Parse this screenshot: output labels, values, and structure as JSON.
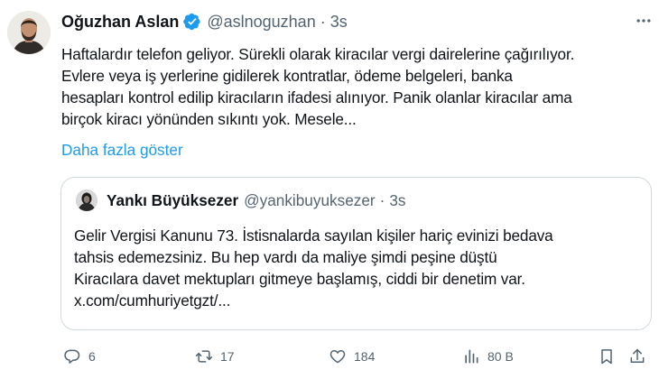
{
  "tweet": {
    "author_name": "Oğuzhan Aslan",
    "handle": "@aslnoguzhan",
    "separator": "·",
    "time": "3s",
    "body_lines": [
      "Haftalardır telefon geliyor. Sürekli olarak kiracılar vergi dairelerine çağırılıyor.",
      "Evlere veya iş yerlerine gidilerek kontratlar, ödeme belgeleri, banka",
      "hesapları kontrol edilip kiracıların ifadesi alınıyor. Panik olanlar kiracılar ama",
      "birçok kiracı yönünden sıkıntı yok. Mesele..."
    ],
    "show_more": "Daha fazla göster"
  },
  "quote": {
    "author_name": "Yankı Büyüksezer",
    "handle": "@yankibuyuksezer",
    "separator": "·",
    "time": "3s",
    "body_lines": [
      "Gelir Vergisi Kanunu 73. İstisnalarda sayılan kişiler hariç evinizi bedava",
      "tahsis edemezsiniz. Bu hep vardı da maliye şimdi peşine düştü",
      "Kiracılara davet mektupları gitmeye başlamış, ciddi bir denetim var.",
      "x.com/cumhuriyetgzt/..."
    ]
  },
  "actions": {
    "replies": "6",
    "reposts": "17",
    "likes": "184",
    "views": "80 B"
  },
  "icons": {
    "verified": "verified-badge-icon",
    "more": "more-dots-icon",
    "reply": "reply-bubble-icon",
    "repost": "repost-arrows-icon",
    "like": "heart-icon",
    "views": "bar-chart-icon",
    "bookmark": "bookmark-icon",
    "share": "share-upload-icon"
  },
  "colors": {
    "text": "#0f1419",
    "secondary": "#536471",
    "link": "#1d9bf0",
    "border": "#cfd9de"
  }
}
